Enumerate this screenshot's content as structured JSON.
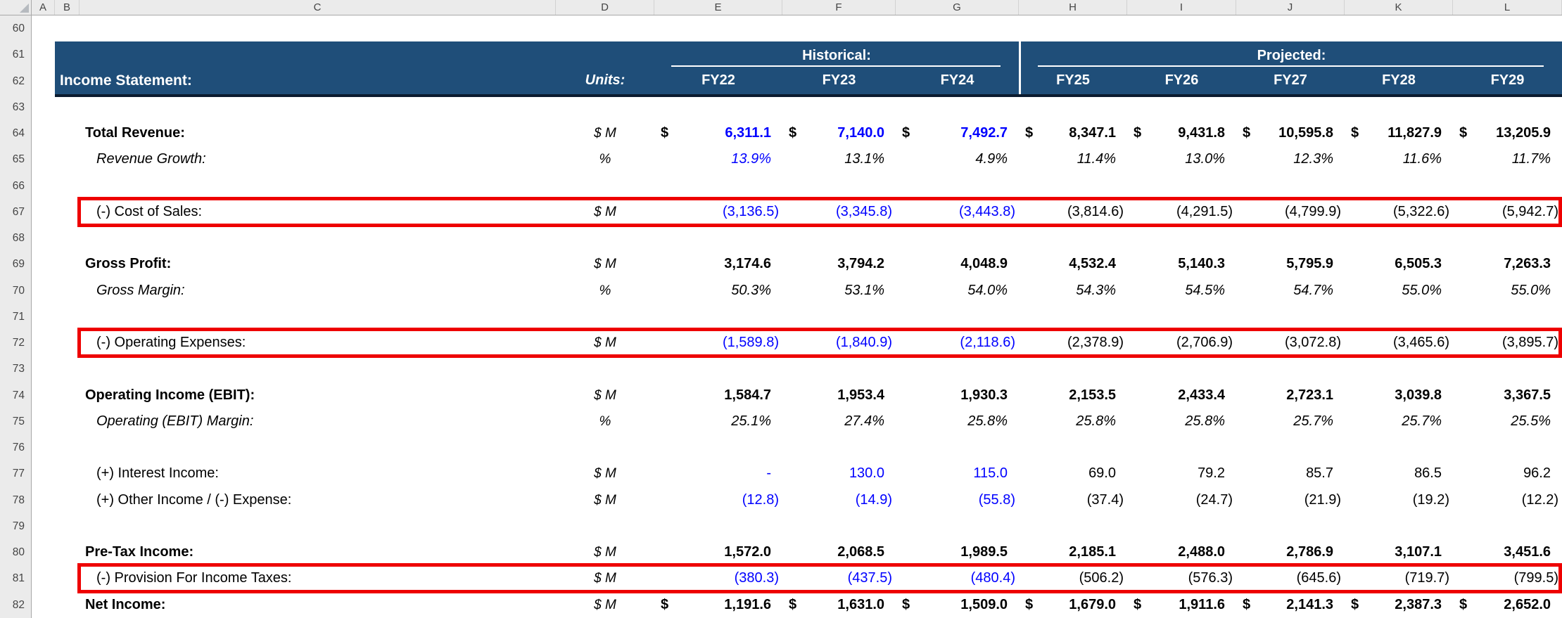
{
  "app": {
    "description": "Excel worksheet - income statement financial model"
  },
  "colors": {
    "header_band": "#1F4E79",
    "band_border": "#0B1B2F",
    "input_blue": "#0000FF",
    "highlight_red": "#EE0000",
    "gutter_bg": "#EBEBEB",
    "gutter_text": "#444444"
  },
  "sheet": {
    "column_headers": [
      "A",
      "B",
      "C",
      "D",
      "E",
      "F",
      "G",
      "H",
      "I",
      "J",
      "K",
      "L"
    ],
    "currency_symbol": "$",
    "header_band": {
      "title": "Income Statement:",
      "units_label": "Units:",
      "group_historical": "Historical:",
      "group_projected": "Projected:",
      "years_historical": [
        "FY22",
        "FY23",
        "FY24"
      ],
      "years_projected": [
        "FY25",
        "FY26",
        "FY27",
        "FY28",
        "FY29"
      ]
    },
    "highlight_rows": [
      67,
      72,
      81
    ],
    "rows": [
      {
        "num": 60
      },
      {
        "num": 61,
        "band": true
      },
      {
        "num": 62,
        "band": true
      },
      {
        "num": 63
      },
      {
        "num": 64,
        "label": "Total Revenue:",
        "units": "$ M",
        "style": "total",
        "dollar": true,
        "blue": [
          1,
          1,
          1,
          0,
          0,
          0,
          0,
          0
        ],
        "values": [
          "6,311.1",
          "7,140.0",
          "7,492.7",
          "8,347.1",
          "9,431.8",
          "10,595.8",
          "11,827.9",
          "13,205.9"
        ]
      },
      {
        "num": 65,
        "label": "Revenue Growth:",
        "units": "%",
        "style": "pct",
        "blue": [
          1,
          0,
          0,
          0,
          0,
          0,
          0,
          0
        ],
        "values": [
          "13.9%",
          "13.1%",
          "4.9%",
          "11.4%",
          "13.0%",
          "12.3%",
          "11.6%",
          "11.7%"
        ]
      },
      {
        "num": 66
      },
      {
        "num": 67,
        "label": "(-) Cost of Sales:",
        "units": "$ M",
        "blue": [
          1,
          1,
          1,
          0,
          0,
          0,
          0,
          0
        ],
        "values": [
          "(3,136.5)",
          "(3,345.8)",
          "(3,443.8)",
          "(3,814.6)",
          "(4,291.5)",
          "(4,799.9)",
          "(5,322.6)",
          "(5,942.7)"
        ]
      },
      {
        "num": 68
      },
      {
        "num": 69,
        "label": "Gross Profit:",
        "units": "$ M",
        "style": "total",
        "blue": [
          0,
          0,
          0,
          0,
          0,
          0,
          0,
          0
        ],
        "values": [
          "3,174.6",
          "3,794.2",
          "4,048.9",
          "4,532.4",
          "5,140.3",
          "5,795.9",
          "6,505.3",
          "7,263.3"
        ]
      },
      {
        "num": 70,
        "label": "Gross Margin:",
        "units": "%",
        "style": "pct",
        "blue": [
          0,
          0,
          0,
          0,
          0,
          0,
          0,
          0
        ],
        "values": [
          "50.3%",
          "53.1%",
          "54.0%",
          "54.3%",
          "54.5%",
          "54.7%",
          "55.0%",
          "55.0%"
        ]
      },
      {
        "num": 71
      },
      {
        "num": 72,
        "label": "(-) Operating Expenses:",
        "units": "$ M",
        "blue": [
          1,
          1,
          1,
          0,
          0,
          0,
          0,
          0
        ],
        "values": [
          "(1,589.8)",
          "(1,840.9)",
          "(2,118.6)",
          "(2,378.9)",
          "(2,706.9)",
          "(3,072.8)",
          "(3,465.6)",
          "(3,895.7)"
        ]
      },
      {
        "num": 73
      },
      {
        "num": 74,
        "label": "Operating Income (EBIT):",
        "units": "$ M",
        "style": "total",
        "blue": [
          0,
          0,
          0,
          0,
          0,
          0,
          0,
          0
        ],
        "values": [
          "1,584.7",
          "1,953.4",
          "1,930.3",
          "2,153.5",
          "2,433.4",
          "2,723.1",
          "3,039.8",
          "3,367.5"
        ]
      },
      {
        "num": 75,
        "label": "Operating (EBIT) Margin:",
        "units": "%",
        "style": "pct",
        "blue": [
          0,
          0,
          0,
          0,
          0,
          0,
          0,
          0
        ],
        "values": [
          "25.1%",
          "27.4%",
          "25.8%",
          "25.8%",
          "25.8%",
          "25.7%",
          "25.7%",
          "25.5%"
        ]
      },
      {
        "num": 76
      },
      {
        "num": 77,
        "label": "(+) Interest Income:",
        "units": "$ M",
        "blue": [
          1,
          1,
          1,
          0,
          0,
          0,
          0,
          0
        ],
        "values": [
          "-",
          "130.0",
          "115.0",
          "69.0",
          "79.2",
          "85.7",
          "86.5",
          "96.2"
        ]
      },
      {
        "num": 78,
        "label": "(+) Other Income / (-) Expense:",
        "units": "$ M",
        "blue": [
          1,
          1,
          1,
          0,
          0,
          0,
          0,
          0
        ],
        "values": [
          "(12.8)",
          "(14.9)",
          "(55.8)",
          "(37.4)",
          "(24.7)",
          "(21.9)",
          "(19.2)",
          "(12.2)"
        ]
      },
      {
        "num": 79
      },
      {
        "num": 80,
        "label": "Pre-Tax Income:",
        "units": "$ M",
        "style": "total",
        "blue": [
          0,
          0,
          0,
          0,
          0,
          0,
          0,
          0
        ],
        "values": [
          "1,572.0",
          "2,068.5",
          "1,989.5",
          "2,185.1",
          "2,488.0",
          "2,786.9",
          "3,107.1",
          "3,451.6"
        ]
      },
      {
        "num": 81,
        "label": "(-) Provision For Income Taxes:",
        "units": "$ M",
        "blue": [
          1,
          1,
          1,
          0,
          0,
          0,
          0,
          0
        ],
        "values": [
          "(380.3)",
          "(437.5)",
          "(480.4)",
          "(506.2)",
          "(576.3)",
          "(645.6)",
          "(719.7)",
          "(799.5)"
        ]
      },
      {
        "num": 82,
        "label": "Net Income:",
        "units": "$ M",
        "style": "total",
        "dollar": true,
        "blue": [
          0,
          0,
          0,
          0,
          0,
          0,
          0,
          0
        ],
        "values": [
          "1,191.6",
          "1,631.0",
          "1,509.0",
          "1,679.0",
          "1,911.6",
          "2,141.3",
          "2,387.3",
          "2,652.0"
        ]
      }
    ]
  }
}
